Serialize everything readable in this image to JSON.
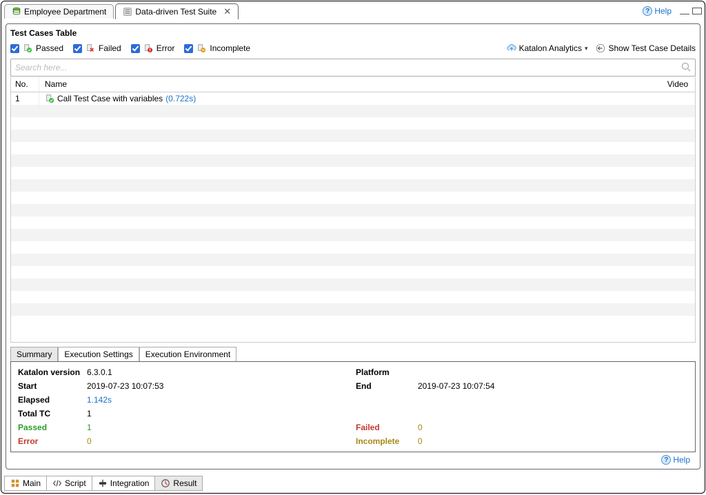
{
  "tabs": {
    "employee": "Employee Department",
    "suite": "Data-driven Test Suite"
  },
  "help_label": "Help",
  "panel_title": "Test Cases Table",
  "filters": {
    "passed": "Passed",
    "failed": "Failed",
    "error": "Error",
    "incomplete": "Incomplete"
  },
  "actions": {
    "analytics": "Katalon Analytics",
    "show_details": "Show Test Case Details"
  },
  "search": {
    "placeholder": "Search here..."
  },
  "table": {
    "headers": {
      "no": "No.",
      "name": "Name",
      "video": "Video"
    },
    "rows": [
      {
        "no": "1",
        "name": "Call Test Case with variables",
        "duration": "(0.722s)"
      }
    ]
  },
  "bottom_tabs": {
    "summary": "Summary",
    "exec_settings": "Execution Settings",
    "exec_env": "Execution Environment"
  },
  "summary": {
    "labels": {
      "version": "Katalon version",
      "platform": "Platform",
      "start": "Start",
      "end": "End",
      "elapsed": "Elapsed",
      "total_tc": "Total TC",
      "passed": "Passed",
      "failed": "Failed",
      "error": "Error",
      "incomplete": "Incomplete"
    },
    "values": {
      "version": "6.3.0.1",
      "platform": "",
      "start": "2019-07-23 10:07:53",
      "end": "2019-07-23 10:07:54",
      "elapsed": "1.142s",
      "total_tc": "1",
      "passed": "1",
      "failed": "0",
      "error": "0",
      "incomplete": "0"
    }
  },
  "bottom_bar": {
    "main": "Main",
    "script": "Script",
    "integration": "Integration",
    "result": "Result"
  }
}
